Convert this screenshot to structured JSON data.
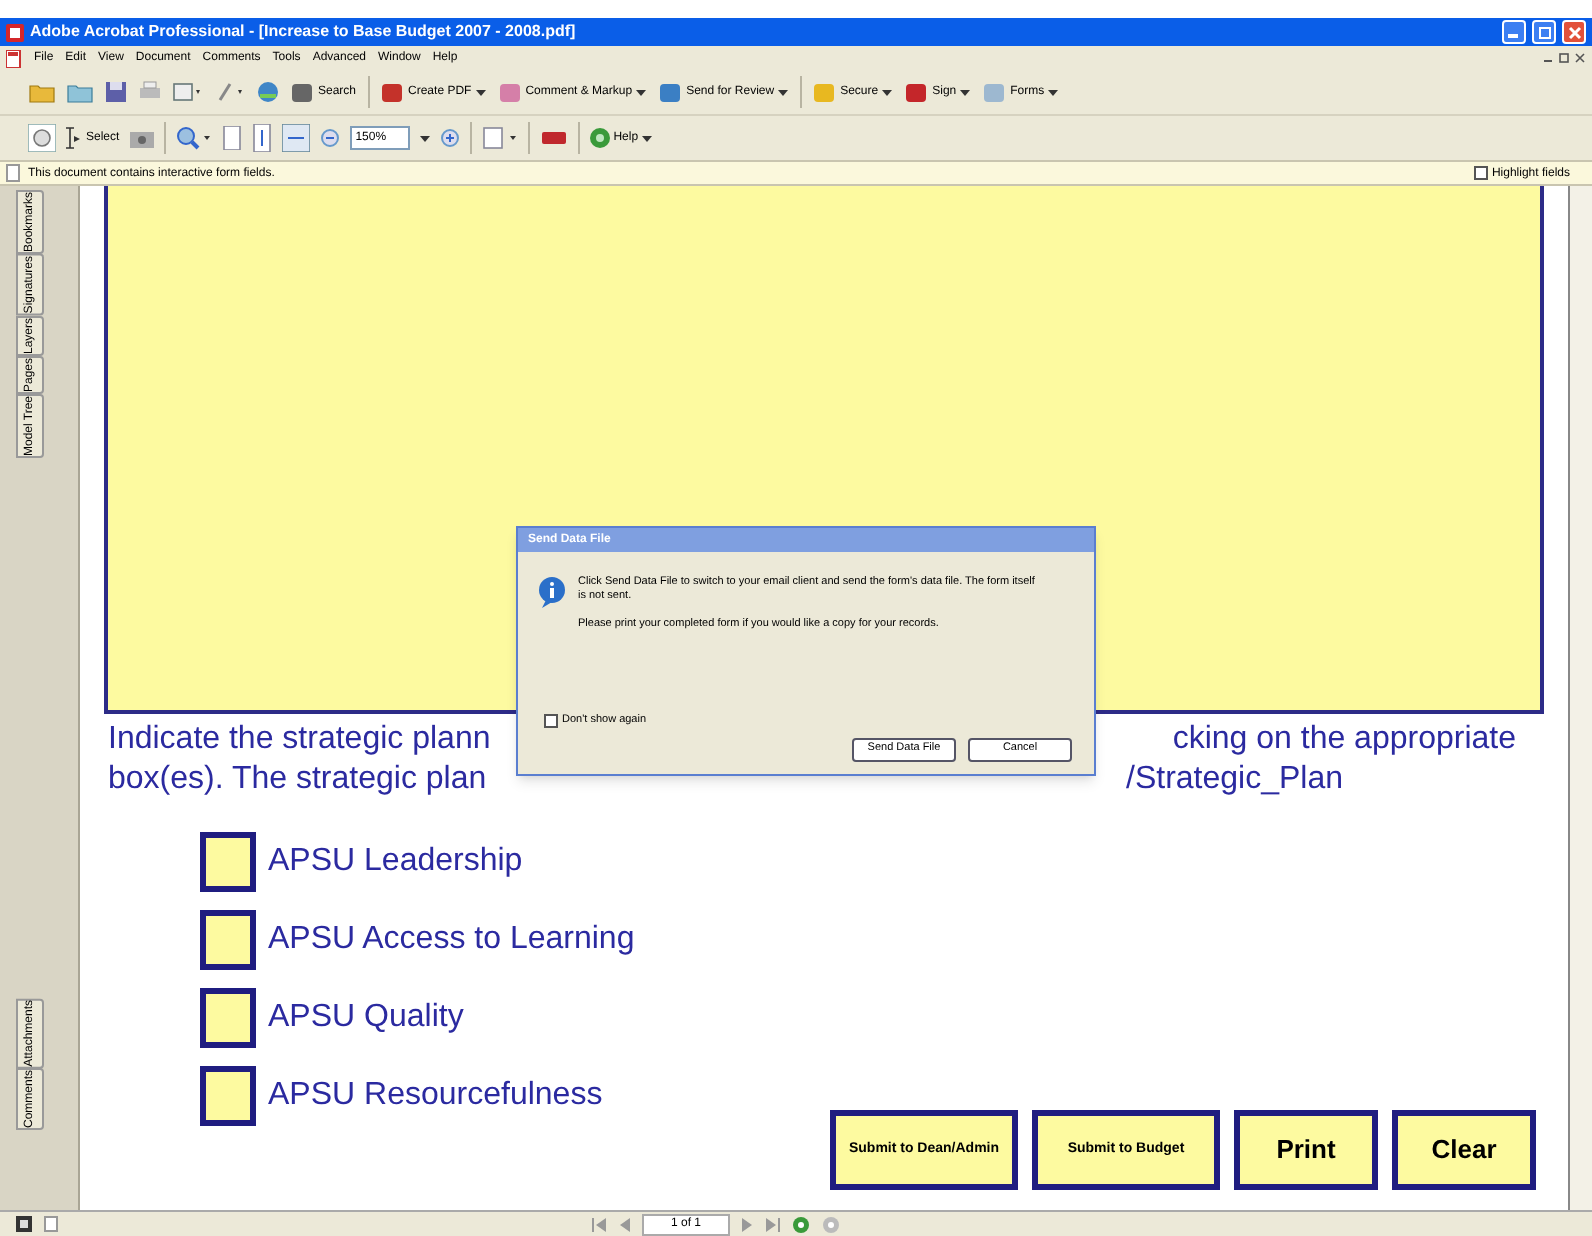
{
  "window": {
    "title": "Adobe Acrobat Professional - [Increase to Base Budget 2007 - 2008.pdf]"
  },
  "menu": [
    "File",
    "Edit",
    "View",
    "Document",
    "Comments",
    "Tools",
    "Advanced",
    "Window",
    "Help"
  ],
  "toolbar_1": [
    "Search",
    "Create PDF",
    "Comment & Markup",
    "Send for Review",
    "Secure",
    "Sign",
    "Forms"
  ],
  "toolbar_2": {
    "select": "Select",
    "zoom": "150%",
    "help": "Help"
  },
  "info_bar": {
    "message": "This document contains interactive form fields.",
    "highlight": {
      "label": "Highlight fields",
      "checked": false
    }
  },
  "side_tabs_top": [
    "Bookmarks",
    "Signatures",
    "Layers",
    "Pages",
    "Model Tree"
  ],
  "side_tabs_bottom": [
    "Attachments",
    "Comments"
  ],
  "instructions": {
    "line_1_start": "Indicate the strategic plann",
    "line_1_end": "cking on the appropriate",
    "line_2_start": "box(es). The strategic plan",
    "line_2_end": "/Strategic_Plan"
  },
  "options": [
    {
      "label": "APSU Leadership",
      "checked": false
    },
    {
      "label": "APSU Access to Learning",
      "checked": false
    },
    {
      "label": "APSU Quality",
      "checked": false
    },
    {
      "label": "APSU Resourcefulness",
      "checked": false
    }
  ],
  "form_buttons": [
    {
      "label": "Submit to Dean/Admin",
      "kind": "small"
    },
    {
      "label": "Submit to Budget",
      "kind": "small"
    },
    {
      "label": "Print",
      "kind": "large"
    },
    {
      "label": "Clear",
      "kind": "large"
    }
  ],
  "dialog": {
    "title": "Send Data File",
    "message_1": "Click Send Data File to switch to your email client and send the form's data file. The form itself is not sent.",
    "message_2": "Please print your completed form if you would like a copy for your records.",
    "dont_show": {
      "label": "Don't show again",
      "checked": false
    },
    "buttons": [
      "Send Data File",
      "Cancel"
    ]
  },
  "status_bar": {
    "page": "1 of 1"
  }
}
